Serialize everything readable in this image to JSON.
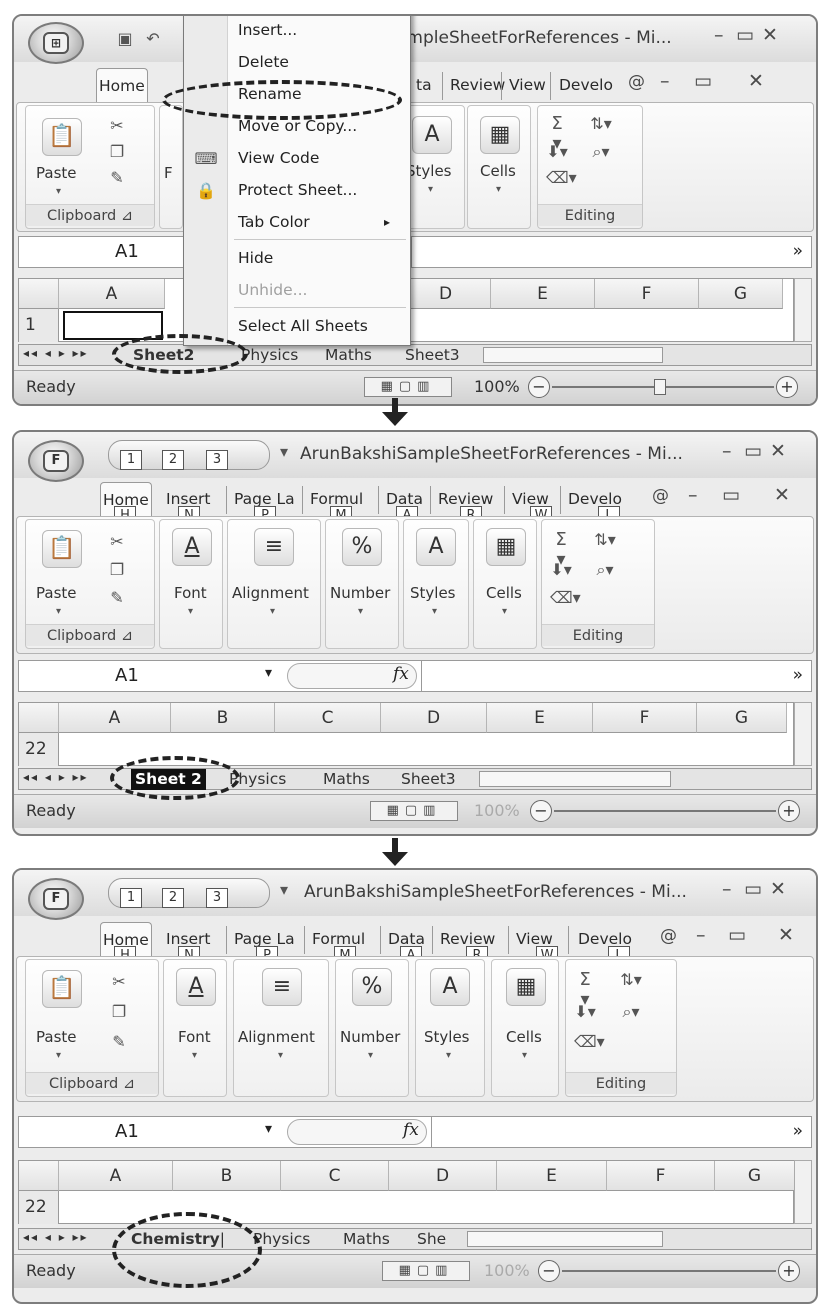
{
  "window": {
    "title_short": "ampleSheetForReferences - Mi...",
    "title": "ArunBakshiSampleSheetForReferences - Mi...",
    "office_button_letter": "F",
    "qat_keytips": [
      "1",
      "2",
      "3"
    ],
    "qat_dropdown": "▾",
    "controls": [
      "–",
      "▭",
      "✕"
    ],
    "ribbon_controls": [
      "@",
      "–",
      "▭",
      "✕"
    ]
  },
  "ribbon": {
    "tabs": [
      "Home",
      "Insert",
      "Page La",
      "Formul",
      "Data",
      "Review",
      "View",
      "Develo"
    ],
    "tabs_panel1_visible": [
      "Home",
      "ta",
      "Review",
      "View",
      "Develo"
    ],
    "keytips": [
      "H",
      "N",
      "P",
      "M",
      "A",
      "R",
      "W",
      "L"
    ],
    "groups": {
      "clipboard": "Clipboard",
      "paste": "Paste",
      "font": "Font",
      "alignment": "Alignment",
      "number": "Number",
      "styles": "Styles",
      "cells": "Cells",
      "editing": "Editing"
    },
    "editing_icons": [
      "Σ",
      "A",
      "Z",
      "ᐯ",
      "⌫"
    ],
    "font_letter": "A",
    "number_symbol": "%",
    "font_letter_fragment": "F"
  },
  "formula_bar": {
    "name_box": "A1",
    "name_dropdown": "▾",
    "fx": "fx",
    "expand": "»"
  },
  "grid": {
    "columns": [
      "A",
      "B",
      "C",
      "D",
      "E",
      "F",
      "G"
    ],
    "row_panel1": "1",
    "row_panel23": "22"
  },
  "sheet_tabs": {
    "nav": "◂◂ ◂ ▸ ▸▸",
    "panel1": [
      "Sheet2",
      "Physics",
      "Maths",
      "Sheet3"
    ],
    "panel2": [
      "Sheet 2",
      "Physics",
      "Maths",
      "Sheet3"
    ],
    "panel3": [
      "Chemistry",
      "Physics",
      "Maths",
      "She"
    ],
    "scroll_thumb": "III"
  },
  "status": {
    "ready": "Ready",
    "zoom": "100%",
    "zoom_minus": "−",
    "zoom_plus": "+",
    "view_buttons": "▦▢▥"
  },
  "context_menu": {
    "items": [
      {
        "label": "Insert...",
        "enabled": true
      },
      {
        "label": "Delete",
        "enabled": true
      },
      {
        "label": "Rename",
        "enabled": true
      },
      {
        "label": "Move or Copy...",
        "enabled": true
      },
      {
        "label": "View Code",
        "enabled": true
      },
      {
        "label": "Protect Sheet...",
        "enabled": true
      },
      {
        "label": "Tab Color",
        "enabled": true
      },
      {
        "label": "Hide",
        "enabled": true
      },
      {
        "label": "Unhide...",
        "enabled": false
      },
      {
        "label": "Select All Sheets",
        "enabled": true
      }
    ],
    "submenu_arrow": "▸"
  },
  "colors": {
    "window_bg": "#ececec",
    "border": "#7d7d7d",
    "annotation": "#222222"
  }
}
